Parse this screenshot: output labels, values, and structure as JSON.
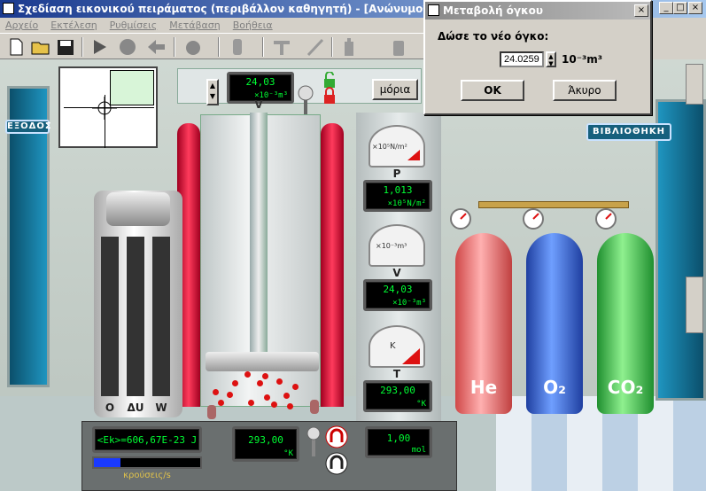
{
  "window": {
    "title": "Σχεδίαση εικονικού πειράματος (περιβάλλον καθηγητή) - [Ανώνυμο*]"
  },
  "menu": [
    "Αρχείο",
    "Εκτέλεση",
    "Ρυθμίσεις",
    "Μετάβαση",
    "Βοήθεια"
  ],
  "dialog": {
    "title": "Μεταβολή όγκου",
    "prompt": "Δώσε το νέο όγκο:",
    "value": "24.0259",
    "unit": "10⁻³m³",
    "ok": "OK",
    "cancel": "Άκυρο"
  },
  "signs": {
    "exit": "ΕΞΟΔΟΣ",
    "library": "ΒΙΒΛΙΟΘΗΚΗ"
  },
  "top_display": {
    "value": "24,03",
    "unit": "×10⁻³m³",
    "label": "V"
  },
  "particles_button": "μόρια",
  "gauges": {
    "pressure": {
      "scale": "×10⁵N/m²",
      "label": "P",
      "value": "1,013",
      "unit": "×10⁵N/m²"
    },
    "volume": {
      "scale": "×10⁻³m³",
      "label": "V",
      "value": "24,03",
      "unit": "×10⁻³m³"
    },
    "temperature": {
      "scale": "K",
      "label": "T",
      "value": "293,00",
      "unit": "°K"
    }
  },
  "thermometers": {
    "labels": [
      "O",
      "ΔU",
      "W"
    ]
  },
  "bottom": {
    "ek": "<Ek>=606,67E-23 J",
    "temp": "293,00",
    "temp_unit": "°K",
    "moles": "1,00",
    "moles_unit": "mol",
    "collisions": "κρούσεις/s",
    "collision_level": 0.25
  },
  "tanks": [
    {
      "label": "He",
      "color": "#f08080"
    },
    {
      "label": "O₂",
      "color": "#3f6fd8"
    },
    {
      "label": "CO₂",
      "color": "#3fbf4f"
    }
  ]
}
